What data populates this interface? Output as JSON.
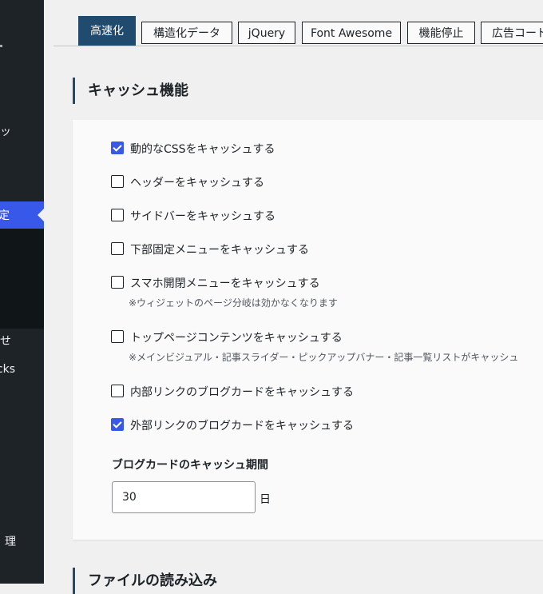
{
  "sidebar": {
    "items": [
      {
        "label": "ッ"
      },
      {
        "label": "定"
      },
      {
        "label": "せ"
      },
      {
        "label": "cks"
      },
      {
        "label": "理"
      }
    ]
  },
  "tabs": [
    {
      "label": "高速化",
      "active": true
    },
    {
      "label": "構造化データ"
    },
    {
      "label": "jQuery"
    },
    {
      "label": "Font Awesome"
    },
    {
      "label": "機能停止"
    },
    {
      "label": "広告コード"
    }
  ],
  "section_cache": {
    "title": "キャッシュ機能",
    "options": [
      {
        "label": "動的なCSSをキャッシュする",
        "checked": true
      },
      {
        "label": "ヘッダーをキャッシュする",
        "checked": false
      },
      {
        "label": "サイドバーをキャッシュする",
        "checked": false
      },
      {
        "label": "下部固定メニューをキャッシュする",
        "checked": false
      },
      {
        "label": "スマホ開閉メニューをキャッシュする",
        "checked": false,
        "note": "※ウィジェットのページ分岐は効かなくなります"
      },
      {
        "label": "トップページコンテンツをキャッシュする",
        "checked": false,
        "note": "※メインビジュアル・記事スライダー・ピックアップバナー・記事一覧リストがキャッシュ"
      },
      {
        "label": "内部リンクのブログカードをキャッシュする",
        "checked": false
      },
      {
        "label": "外部リンクのブログカードをキャッシュする",
        "checked": true
      }
    ],
    "blogcard_period": {
      "title": "ブログカードのキャッシュ期間",
      "value": "30",
      "unit": "日"
    }
  },
  "section_files": {
    "title": "ファイルの読み込み"
  },
  "colors": {
    "accent": "#204a6e",
    "checkbox_checked": "#3858e9",
    "sidebar_bg": "#1d2327",
    "sidebar_active": "#3858e9"
  }
}
